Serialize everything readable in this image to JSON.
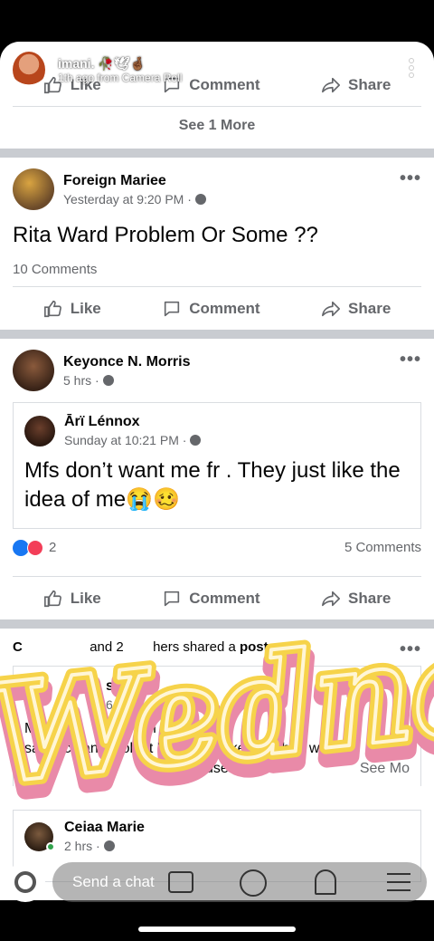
{
  "story": {
    "user": "imani.",
    "emoji": "🥀🕊🤞🏾",
    "subtitle": "1th ago from Camera Roll"
  },
  "top_post": {
    "like": "Like",
    "comment": "Comment",
    "share": "Share",
    "see_more": "See 1 More"
  },
  "post1": {
    "name": "Foreign Mariee",
    "time": "Yesterday at 9:20 PM ·",
    "text": "Rita Ward Problem Or Some ??",
    "comments": "10 Comments",
    "like": "Like",
    "comment": "Comment",
    "share": "Share"
  },
  "post2": {
    "name": "Keyonce N. Morris",
    "time": "5 hrs ·",
    "shared_name": "Ārï Lénnox",
    "shared_time": "Sunday at 10:21 PM ·",
    "shared_text": "Mfs don’t want me fr . They just like the idea of me😭🥴",
    "reactions_count": "2",
    "comments": "5 Comments",
    "like": "Like",
    "comment": "Comment",
    "share": "Share"
  },
  "post3": {
    "header_prefix": "C",
    "header_mid": "and 2",
    "header_suffix": "hers shared a",
    "header_link": "post.",
    "inner_name": "s F",
    "inner_time": "6",
    "text_line1": "My home   me h     n hom  i     s.",
    "text_line2": "sat back and look at him . He asked m   hy I w  s",
    "text_line3": "use   do    a",
    "see_more": "See Mo"
  },
  "post4": {
    "name": "Ceiaa Marie",
    "time": "2 hrs ·"
  },
  "sticker": {
    "text": "Wednesday"
  },
  "chat": {
    "placeholder": "Send a chat"
  },
  "colors": {
    "fb_blue": "#1877f2",
    "sticker_yellow": "#f6d34a",
    "sticker_pink": "#e98aa8"
  }
}
